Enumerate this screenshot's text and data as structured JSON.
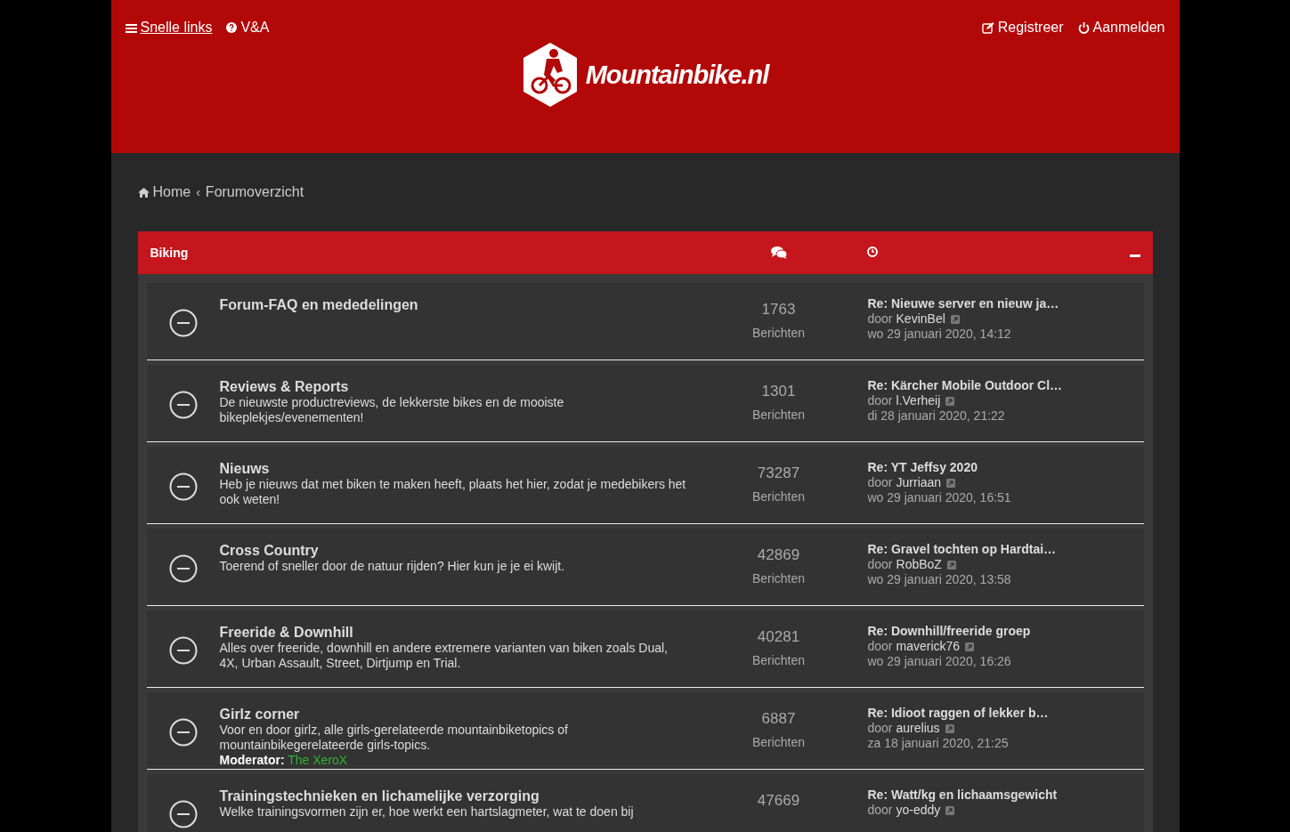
{
  "header": {
    "nav_left": [
      {
        "kind": "menu",
        "label": "Snelle links"
      },
      {
        "kind": "help",
        "label": "V&A"
      }
    ],
    "nav_right": [
      {
        "kind": "register",
        "label": "Registreer"
      },
      {
        "kind": "power",
        "label": "Aanmelden"
      }
    ],
    "logo": "Mountainbike.nl"
  },
  "breadcrumb": {
    "items": [
      "Home",
      "Forumoverzicht"
    ],
    "separator": "‹"
  },
  "category": {
    "title": "Biking",
    "expanded": true,
    "forums": [
      {
        "title": "Forum-FAQ en mededelingen",
        "posts": "1763",
        "posts_label": "Berichten",
        "last_post": {
          "title": "Re: Nieuwe server en nieuw ja…",
          "by": "door",
          "author": "KevinBel",
          "date": "wo 29 januari 2020, 14:12"
        }
      },
      {
        "title": "Reviews & Reports",
        "description": "De nieuwste productreviews, de lekkerste bikes en de mooiste bikeplekjes/evenementen!",
        "posts": "1301",
        "posts_label": "Berichten",
        "last_post": {
          "title": "Re: Kärcher Mobile Outdoor Cl…",
          "by": "door",
          "author": "l.Verheij",
          "date": "di 28 januari 2020, 21:22"
        }
      },
      {
        "title": "Nieuws",
        "description": "Heb je nieuws dat met biken te maken heeft, plaats het hier, zodat je medebikers het ook weten!",
        "posts": "73287",
        "posts_label": "Berichten",
        "last_post": {
          "title": "Re: YT Jeffsy 2020",
          "by": "door",
          "author": "Jurriaan",
          "date": "wo 29 januari 2020, 16:51"
        }
      },
      {
        "title": "Cross Country",
        "description": "Toerend of sneller door de natuur rijden? Hier kun je je ei kwijt.",
        "posts": "42869",
        "posts_label": "Berichten",
        "last_post": {
          "title": "Re: Gravel tochten op Hardtai…",
          "by": "door",
          "author": "RobBoZ",
          "date": "wo 29 januari 2020, 13:58"
        }
      },
      {
        "title": "Freeride & Downhill",
        "description": "Alles over freeride, downhill en andere extremere varianten van biken zoals Dual, 4X, Urban Assault, Street, Dirtjump en Trial.",
        "posts": "40281",
        "posts_label": "Berichten",
        "last_post": {
          "title": "Re: Downhill/freeride groep",
          "by": "door",
          "author": "maverick76",
          "date": "wo 29 januari 2020, 16:26"
        }
      },
      {
        "title": "Girlz corner",
        "description": "Voor en door girlz, alle girls-gerelateerde mountainbiketopics of mountainbikegerelateerde girls-topics.",
        "moderator_label": "Moderator:",
        "moderator": "The XeroX",
        "posts": "6887",
        "posts_label": "Berichten",
        "last_post": {
          "title": "Re: Idioot raggen of lekker b…",
          "by": "door",
          "author": "aurelius",
          "date": "za 18 januari 2020, 21:25"
        }
      },
      {
        "title": "Trainingstechnieken en lichamelijke verzorging",
        "description": "Welke trainingsvormen zijn er, hoe werkt een hartslagmeter, wat te doen bij",
        "posts": "47669",
        "last_post": {
          "title": "Re: Watt/kg en lichaamsgewicht",
          "by": "door",
          "author": "yo-eddy"
        }
      }
    ]
  }
}
